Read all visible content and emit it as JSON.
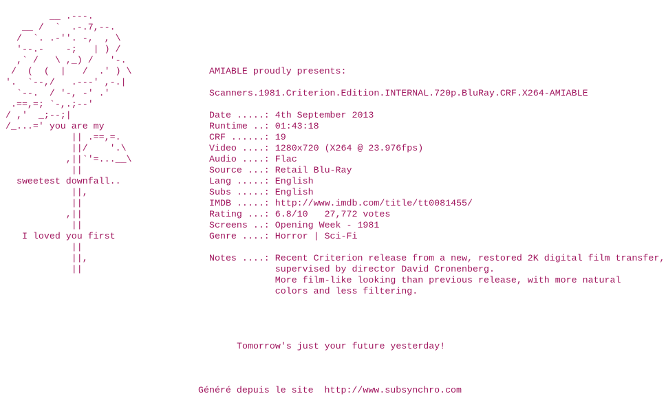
{
  "ascii_art_lines": [
    "        __ .---.",
    "   __ /  `  .-.7,--.",
    "  /  `. .-''. -,  , \\",
    "  '--.-    -;   | ) /",
    "  ,` /   \\ ,_) /   '-.",
    " /  (  (  |   /  .' ) \\",
    "'.  `--,/   .---' ,-.|",
    "  `--.  / '-, -' .'",
    " .==,=; `-,.;--'",
    "/ ,'  _;--;|",
    "/_...=' you are my",
    "            || .==,=.",
    "            ||/    '.\\",
    "           ,||`'=...__\\",
    "            ||",
    "  sweetest downfall..",
    "            ||,",
    "            ||",
    "           ,||",
    "            ||",
    "   I loved you first",
    "            ||",
    "            ||,",
    "            ||"
  ],
  "info_lines": [
    "AMIABLE proudly presents:",
    "",
    "Scanners.1981.Criterion.Edition.INTERNAL.720p.BluRay.CRF.X264-AMIABLE",
    "",
    "Date .....: 4th September 2013",
    "Runtime ..: 01:43:18",
    "CRF ......: 19",
    "Video ....: 1280x720 (X264 @ 23.976fps)",
    "Audio ....: Flac",
    "Source ...: Retail Blu-Ray",
    "Lang .....: English",
    "Subs .....: English",
    "IMDB .....: http://www.imdb.com/title/tt0081455/",
    "Rating ...: 6.8/10   27,772 votes",
    "Screens ..: Opening Week - 1981",
    "Genre ....: Horror | Sci-Fi",
    "",
    "Notes ....: Recent Criterion release from a new, restored 2K digital film transfer,",
    "            supervised by director David Cronenberg.",
    "            More film-like looking than previous release, with more natural",
    "            colors and less filtering."
  ],
  "tagline": "Tomorrow's just your future yesterday!",
  "footer": "Généré depuis le site  http://www.subsynchro.com",
  "colors": {
    "text": "#a0165e",
    "background": "#ffffff"
  }
}
